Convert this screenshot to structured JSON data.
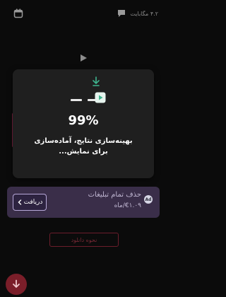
{
  "header": {
    "size_label": "۴.۲ مگابایت",
    "calendar_icon": "calendar-icon",
    "chat_icon": "chat-icon"
  },
  "player": {
    "play_icon": "play-icon"
  },
  "overlay": {
    "percent": "99%",
    "status": "بهینه‌سازی نتایج، آماده‌سازی برای نمایش...",
    "arrow_icon": "download-arrow-icon",
    "thumb_icon": "media-thumb-icon",
    "accent_color": "#3fb58f"
  },
  "ad_banner": {
    "title": "حذف تمام تبلیغات",
    "price": "€۱.۰۹/ماه",
    "badge": "Ad",
    "get_label": "دریافت",
    "bg_color": "#3a2e49"
  },
  "actions": {
    "how_to_download": "نحوه دانلود",
    "fab_icon": "download-icon",
    "fab_color": "#7a1e29"
  }
}
